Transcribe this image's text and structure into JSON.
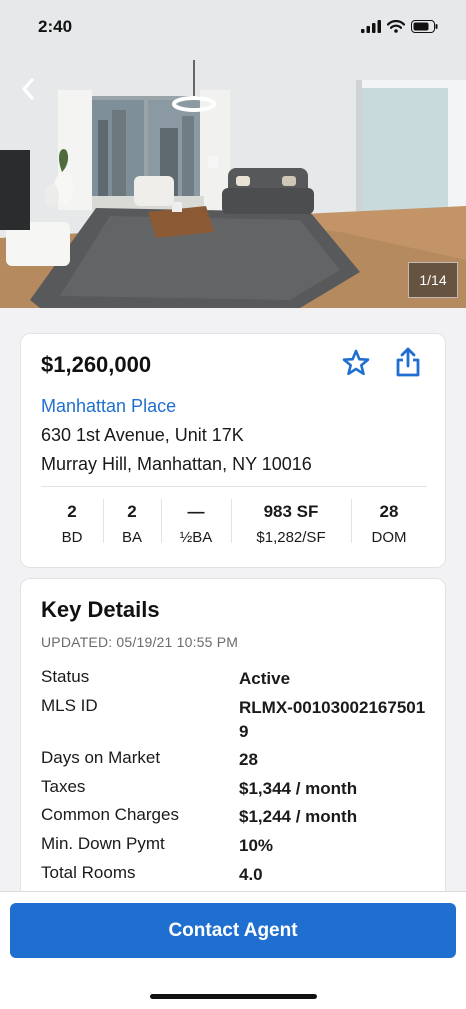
{
  "status_bar": {
    "time": "2:40"
  },
  "hero": {
    "photo_counter": "1/14"
  },
  "summary": {
    "price": "$1,260,000",
    "building_name": "Manhattan Place",
    "address_line1": "630 1st Avenue, Unit 17K",
    "address_line2": "Murray Hill, Manhattan, NY 10016",
    "stats": [
      {
        "value": "2",
        "label": "BD"
      },
      {
        "value": "2",
        "label": "BA"
      },
      {
        "value": "—",
        "label": "½BA"
      },
      {
        "value": "983 SF",
        "label": "$1,282/SF"
      },
      {
        "value": "28",
        "label": "DOM"
      }
    ]
  },
  "key_details": {
    "title": "Key Details",
    "updated": "UPDATED: 05/19/21 10:55 PM",
    "rows": [
      {
        "key": "Status",
        "value": "Active"
      },
      {
        "key": "MLS ID",
        "value": "RLMX-001030021675019"
      },
      {
        "key": "Days on Market",
        "value": "28"
      },
      {
        "key": "Taxes",
        "value": "$1,344 / month"
      },
      {
        "key": "Common Charges",
        "value": "$1,244 / month"
      },
      {
        "key": "Min. Down Pymt",
        "value": "10%"
      },
      {
        "key": "Total Rooms",
        "value": "4.0"
      }
    ]
  },
  "bottom": {
    "contact_label": "Contact Agent"
  },
  "colors": {
    "accent": "#1f6fd1",
    "card_bg": "#ffffff",
    "page_bg": "#f2f2f4"
  },
  "icons": [
    "back-chevron-icon",
    "star-outline-icon",
    "share-icon",
    "signal-icon",
    "wifi-icon",
    "battery-icon"
  ]
}
